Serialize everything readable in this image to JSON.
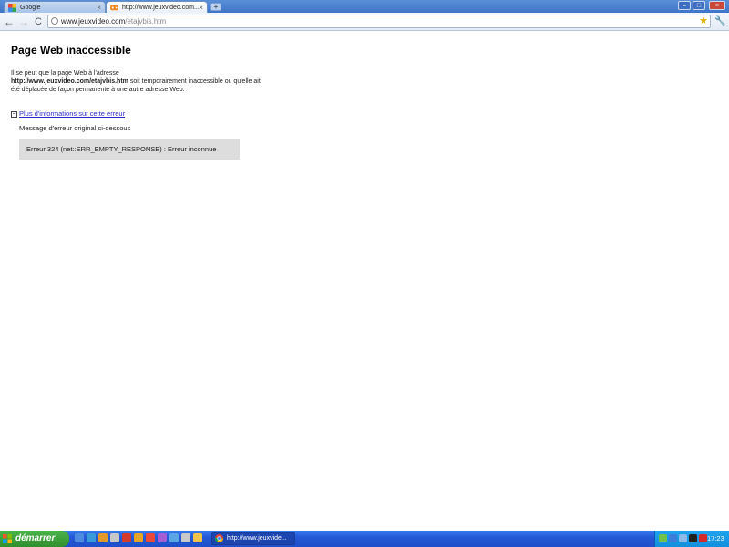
{
  "tabs": [
    {
      "label": "Google",
      "close": "×",
      "active": false
    },
    {
      "label": "http://www.jeuxvideo.com...",
      "close": "×",
      "active": true
    }
  ],
  "new_tab_label": "+",
  "window_controls": {
    "minimize": "–",
    "maximize": "□",
    "close": "×"
  },
  "toolbar": {
    "back": "←",
    "forward": "→",
    "reload": "C",
    "url_host": "www.jeuxvideo.com",
    "url_path": "/etajvbis.htm",
    "star": "★",
    "wrench": "🔧"
  },
  "page": {
    "title": "Page Web inaccessible",
    "desc_line1": "Il se peut que la page Web à l'adresse",
    "desc_url": "http://www.jeuxvideo.com/etajvbis.htm",
    "desc_line2": " soit temporairement inaccessible ou qu'elle ait été déplacée de façon permanente à une autre adresse Web.",
    "more_toggle": "−",
    "more_link": "Plus d'informations sur cette erreur",
    "original_msg": "Message d'erreur original ci-dessous",
    "error_text": "Erreur 324 (net::ERR_EMPTY_RESPONSE) : Erreur inconnue"
  },
  "taskbar": {
    "start_label": "démarrer",
    "task_label": "http://www.jeuxvide...",
    "clock": "17:23"
  },
  "colors": {
    "link": "#2b2bcc",
    "error_box": "#dddddd",
    "taskbar_blue": "#2458d6",
    "start_green": "#3a9e38"
  }
}
